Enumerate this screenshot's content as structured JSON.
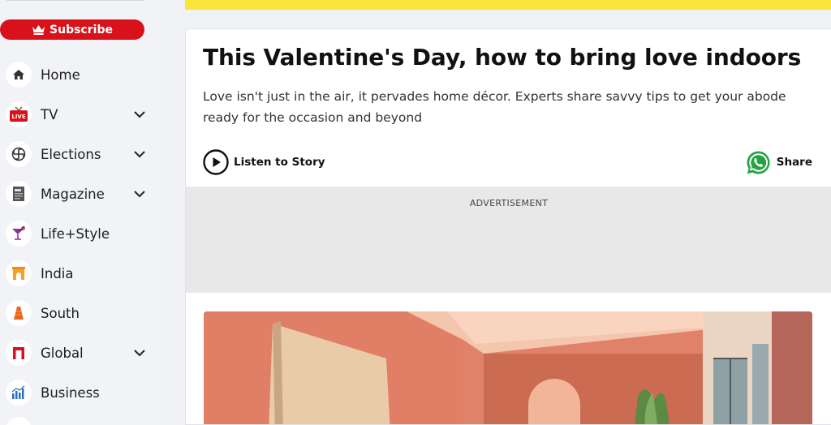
{
  "sidebar": {
    "subscribe_label": "Subscribe",
    "items": [
      {
        "label": "Home",
        "icon": "home-icon",
        "has_chevron": false
      },
      {
        "label": "TV",
        "icon": "live-tv-icon",
        "has_chevron": true
      },
      {
        "label": "Elections",
        "icon": "elections-icon",
        "has_chevron": true
      },
      {
        "label": "Magazine",
        "icon": "magazine-icon",
        "has_chevron": true
      },
      {
        "label": "Life+Style",
        "icon": "cocktail-icon",
        "has_chevron": false
      },
      {
        "label": "India",
        "icon": "india-gate-icon",
        "has_chevron": false
      },
      {
        "label": "South",
        "icon": "temple-icon",
        "has_chevron": false
      },
      {
        "label": "Global",
        "icon": "global-icon",
        "has_chevron": true
      },
      {
        "label": "Business",
        "icon": "business-chart-icon",
        "has_chevron": false
      }
    ]
  },
  "article": {
    "title": "This Valentine's Day, how to bring love indoors",
    "subtitle": "Love isn't just in the air, it pervades home décor. Experts share savvy tips to get your abode ready for the occasion and beyond",
    "listen_label": "Listen to Story",
    "share_label": "Share",
    "ad_label": "ADVERTISEMENT"
  },
  "colors": {
    "accent": "#d8111a",
    "banner": "#f9e53a",
    "whatsapp": "#25a244"
  }
}
